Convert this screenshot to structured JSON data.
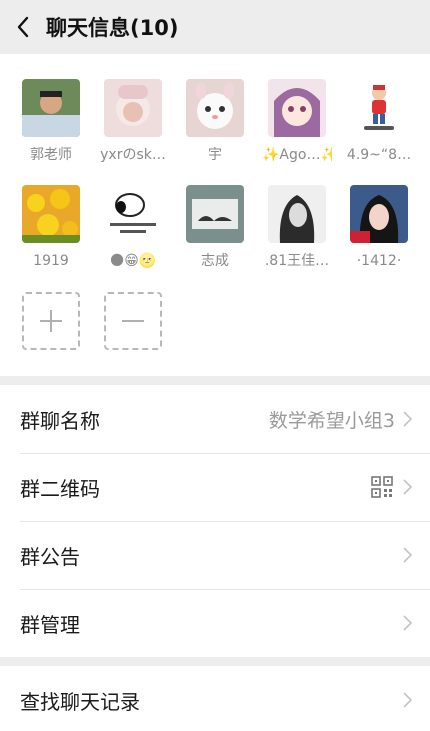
{
  "header": {
    "title": "聊天信息(10)",
    "back_icon": "chevron-left-icon"
  },
  "members": [
    {
      "name": "郭老师"
    },
    {
      "name": "yxrのsk…"
    },
    {
      "name": "宇"
    },
    {
      "name": "✨Ago…✨"
    },
    {
      "name": "4.9~“8…"
    },
    {
      "name": "1919"
    },
    {
      "name": "🌑😁🌝"
    },
    {
      "name": "志成"
    },
    {
      "name": ".81王佳…"
    },
    {
      "name": "·1412·"
    }
  ],
  "member_actions": {
    "add_icon": "plus-icon",
    "remove_icon": "minus-icon"
  },
  "settings": {
    "group_name_label": "群聊名称",
    "group_name_value": "数学希望小组3",
    "qr_label": "群二维码",
    "qr_icon": "qr-code-icon",
    "notice_label": "群公告",
    "manage_label": "群管理",
    "search_label": "查找聊天记录",
    "arrow_icon": "chevron-right-icon"
  },
  "colors": {
    "background": "#ededed",
    "card": "#ffffff",
    "muted": "#9a9a9a"
  }
}
